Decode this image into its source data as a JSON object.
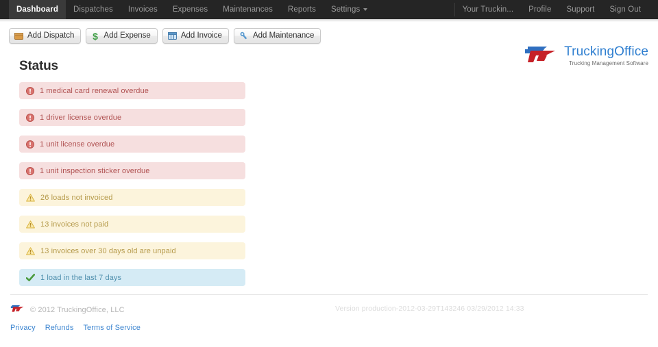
{
  "nav": {
    "left_items": [
      {
        "label": "Dashboard",
        "active": true,
        "dropdown": false
      },
      {
        "label": "Dispatches",
        "active": false,
        "dropdown": false
      },
      {
        "label": "Invoices",
        "active": false,
        "dropdown": false
      },
      {
        "label": "Expenses",
        "active": false,
        "dropdown": false
      },
      {
        "label": "Maintenances",
        "active": false,
        "dropdown": false
      },
      {
        "label": "Reports",
        "active": false,
        "dropdown": false
      },
      {
        "label": "Settings",
        "active": false,
        "dropdown": true
      }
    ],
    "right_items": [
      {
        "label": "Your Truckin..."
      },
      {
        "label": "Profile"
      },
      {
        "label": "Support"
      },
      {
        "label": "Sign Out"
      }
    ]
  },
  "toolbar": {
    "buttons": [
      {
        "label": "Add Dispatch",
        "icon": "box-icon"
      },
      {
        "label": "Add Expense",
        "icon": "dollar-icon"
      },
      {
        "label": "Add Invoice",
        "icon": "table-icon"
      },
      {
        "label": "Add Maintenance",
        "icon": "wrench-icon"
      }
    ]
  },
  "brand": {
    "name": "TruckingOffice",
    "tagline": "Trucking Management Software",
    "name_color": "#2f7fd0",
    "mark_blue": "#2f6fc0",
    "mark_red": "#c62128"
  },
  "main": {
    "title": "Status",
    "alerts": [
      {
        "text": "1 medical card renewal overdue",
        "type": "error",
        "icon": "error-circle-icon"
      },
      {
        "text": "1 driver license overdue",
        "type": "error",
        "icon": "error-circle-icon"
      },
      {
        "text": "1 unit license overdue",
        "type": "error",
        "icon": "error-circle-icon"
      },
      {
        "text": "1 unit inspection sticker overdue",
        "type": "error",
        "icon": "error-circle-icon"
      },
      {
        "text": "26 loads not invoiced",
        "type": "warning",
        "icon": "warning-triangle-icon"
      },
      {
        "text": "13 invoices not paid",
        "type": "warning",
        "icon": "warning-triangle-icon"
      },
      {
        "text": "13 invoices over 30 days old are unpaid",
        "type": "warning",
        "icon": "warning-triangle-icon"
      },
      {
        "text": "1 load in the last 7 days",
        "type": "info",
        "icon": "check-icon"
      }
    ]
  },
  "footer": {
    "copyright": "© 2012 TruckingOffice, LLC",
    "version": "Version production-2012-03-29T143246 03/29/2012 14:33",
    "links": [
      {
        "label": "Privacy"
      },
      {
        "label": "Refunds"
      },
      {
        "label": "Terms of Service"
      }
    ]
  },
  "colors": {
    "nav_bg": "#252525",
    "nav_active_bg": "#3a3a3a",
    "error_bg": "#f6dfdf",
    "error_fg": "#b05252",
    "warning_bg": "#fcf4dc",
    "warning_fg": "#b59a4b",
    "info_bg": "#d5ebf5",
    "info_fg": "#4f8fad",
    "link": "#3c85d0"
  }
}
